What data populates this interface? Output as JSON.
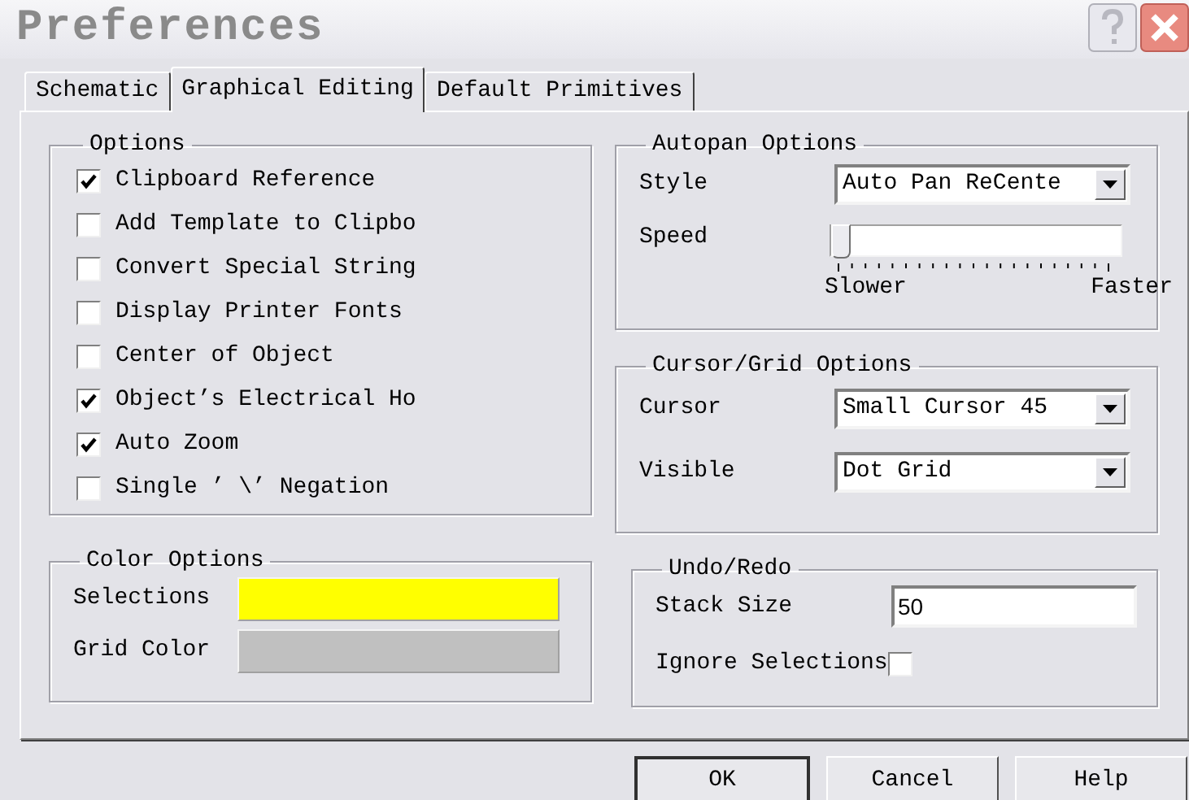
{
  "window": {
    "title": "Preferences"
  },
  "tabs": [
    {
      "label": "Schematic",
      "selected": false
    },
    {
      "label": "Graphical Editing",
      "selected": true
    },
    {
      "label": "Default Primitives",
      "selected": false
    }
  ],
  "options": {
    "title": "Options",
    "items": [
      {
        "label": "Clipboard Reference",
        "checked": true
      },
      {
        "label": "Add Template to Clipbo",
        "checked": false
      },
      {
        "label": "Convert Special String",
        "checked": false
      },
      {
        "label": "Display Printer Fonts",
        "checked": false
      },
      {
        "label": "Center of Object",
        "checked": false
      },
      {
        "label": "Object’s Electrical Ho",
        "checked": true
      },
      {
        "label": "Auto Zoom",
        "checked": true
      },
      {
        "label": "Single ’ \\’ Negation",
        "checked": false
      }
    ]
  },
  "color_options": {
    "title": "Color Options",
    "items": [
      {
        "label": "Selections",
        "color": "#ffff00"
      },
      {
        "label": "Grid Color",
        "color": "#c0c0c0"
      }
    ]
  },
  "autopan": {
    "title": "Autopan Options",
    "style": {
      "label": "Style",
      "value": "Auto Pan ReCente"
    },
    "speed": {
      "label": "Speed",
      "level": 0,
      "min_label": "Slower",
      "max_label": "Faster"
    }
  },
  "cursor_grid": {
    "title": "Cursor/Grid Options",
    "rows": [
      {
        "label": "Cursor",
        "value": "Small Cursor 45"
      },
      {
        "label": "Visible",
        "value": "Dot Grid"
      }
    ]
  },
  "undo_redo": {
    "title": "Undo/Redo",
    "stack_size": {
      "label": "Stack Size",
      "value": "50"
    },
    "ignore_selections": {
      "label": "Ignore Selections",
      "checked": false
    }
  },
  "buttons": [
    {
      "label": "OK",
      "default": true
    },
    {
      "label": "Cancel",
      "default": false
    },
    {
      "label": "Help",
      "default": false
    }
  ]
}
